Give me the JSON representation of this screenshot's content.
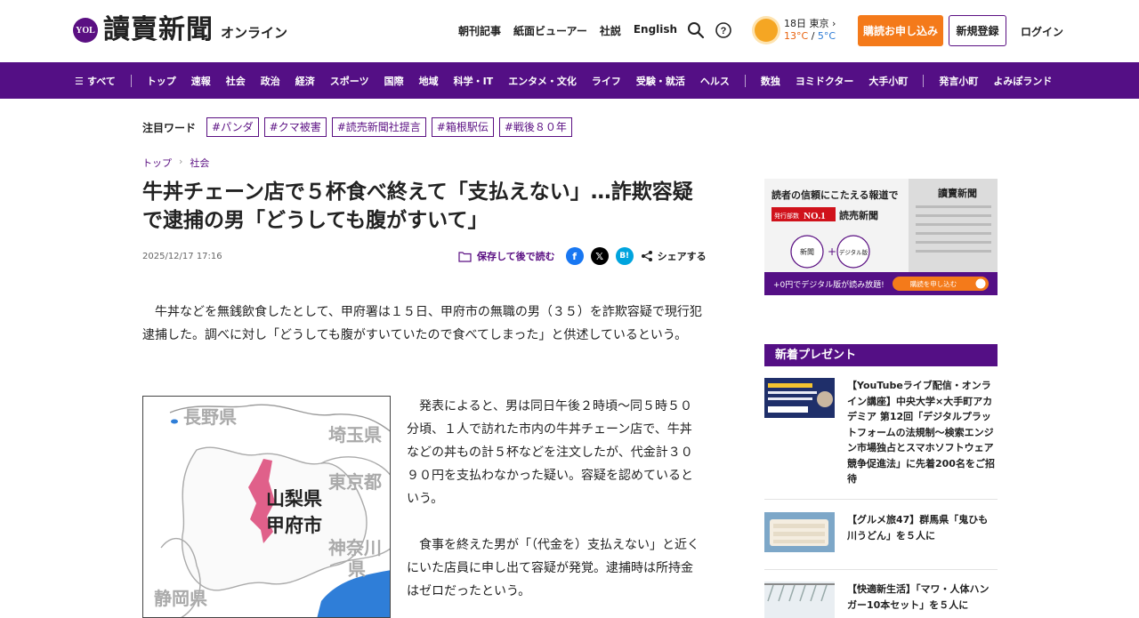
{
  "header": {
    "logo_badge": "YOL",
    "logo_text": "讀賣新聞",
    "logo_sub": "オンライン",
    "nav": [
      "朝刊記事",
      "紙面ビューアー",
      "社説",
      "English"
    ],
    "weather_date_city": "18日 東京",
    "weather_high": "13°C",
    "weather_sep": "/",
    "weather_low": "5°C",
    "subscribe_label": "購読お申し込み",
    "register_label": "新規登録",
    "login_label": "ログイン"
  },
  "mainnav": {
    "all_label": "すべて",
    "items": [
      "トップ",
      "速報",
      "社会",
      "政治",
      "経済",
      "スポーツ",
      "国際",
      "地域",
      "科学・IT",
      "エンタメ・文化",
      "ライフ",
      "受験・就活",
      "ヘルス"
    ],
    "items2": [
      "数独",
      "ヨミドクター",
      "大手小町"
    ],
    "items3": [
      "発言小町",
      "よみぽランド"
    ]
  },
  "attention": {
    "label": "注目ワード",
    "tags": [
      "#パンダ",
      "#クマ被害",
      "#読売新聞社提言",
      "#箱根駅伝",
      "#戦後８０年"
    ]
  },
  "breadcrumb": [
    "トップ",
    "社会"
  ],
  "article": {
    "title": "牛丼チェーン店で５杯食べ終えて「支払えない」…詐欺容疑で逮捕の男「どうしても腹がすいて」",
    "date": "2025/12/17 17:16",
    "save_label": "保存して後で読む",
    "share_label": "シェアする",
    "lead": "牛丼などを無銭飲食したとして、甲府署は１５日、甲府市の無職の男（３５）を詐欺容疑で現行犯逮捕した。調べに対し「どうしても腹がすいていたので食べてしまった」と供述しているという。",
    "paragraphs": [
      "発表によると、男は同日午後２時頃～同５時５０分頃、１人で訪れた市内の牛丼チェーン店で、牛丼などの丼もの計５杯などを注文したが、代金計３０９０円を支払わなかった疑い。容疑を認めているという。",
      "食事を終えた男が「（代金を）支払えない」と近くにいた店員に申し出て容疑が発覚。逮捕時は所持金はゼロだったという。"
    ],
    "map_labels": {
      "nagano": "長野県",
      "saitama": "埼玉県",
      "tokyo": "東京都",
      "yamanashi": "山梨県",
      "kofu": "甲府市",
      "kanagawa1": "神奈川",
      "kanagawa2": "県",
      "shizuoka": "静岡県"
    }
  },
  "ad": {
    "headline": "読者の信頼にこたえる報道で",
    "brand": "讀賣新聞",
    "badge_pre": "発行部数",
    "badge": "NO.1",
    "badge_post": "読売新聞",
    "circle1": "新聞",
    "plus": "+",
    "circle2": "デジタル版",
    "footer_text": "+0円でデジタル版が読み放題!",
    "footer_btn": "購読を申し込む"
  },
  "sidebar": {
    "section_title": "新着プレゼント",
    "items": [
      {
        "text": "【YouTubeライブ配信・オンライン講座】中央大学×大手町アカデミア 第12回「デジタルプラットフォームの法規制～検索エンジン市場独占とスマホソフトウェア競争促進法」に先着200名をご招待"
      },
      {
        "text": "【グルメ旅47】群馬県「鬼ひも川うどん」を５人に"
      },
      {
        "text": "【快適新生活】「マワ・人体ハンガー10本セット」を５人に"
      }
    ]
  },
  "colors": {
    "brand_purple": "#540f85",
    "subscribe_orange": "#f47a1a",
    "map_highlight": "#e0608a",
    "facebook": "#1877f2",
    "x": "#000000",
    "hatena": "#00a4de"
  }
}
